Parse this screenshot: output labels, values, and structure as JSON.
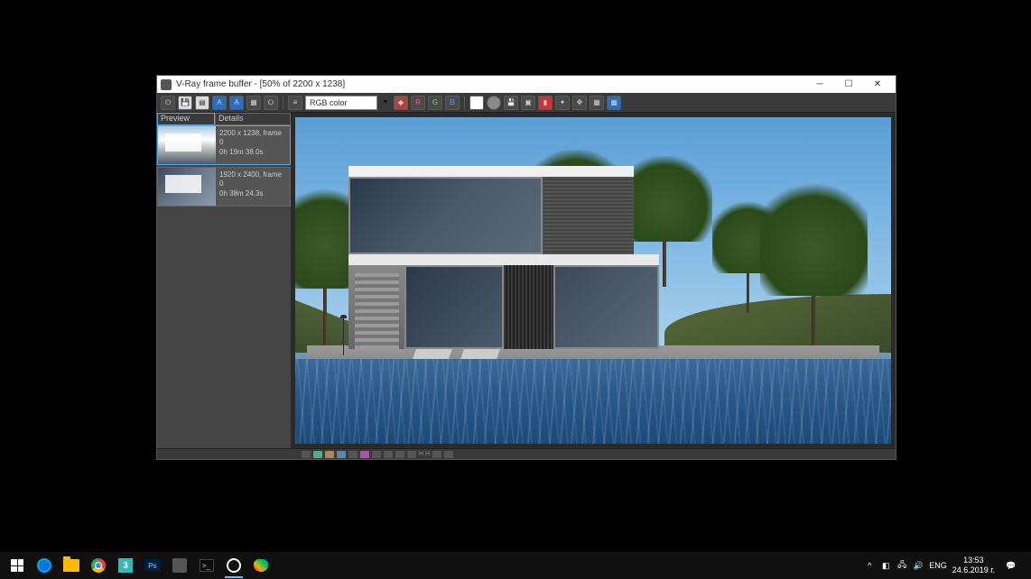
{
  "window": {
    "title": "V-Ray frame buffer - [50% of 2200 x 1238]"
  },
  "toolbar": {
    "channel_label": "RGB color",
    "r": "R",
    "g": "G",
    "b": "B",
    "h_label": "H"
  },
  "sidebar": {
    "preview_header": "Preview",
    "details_header": "Details",
    "history": [
      {
        "line1": "2200 x 1238, frame 0",
        "line2": "0h 19m 38.0s",
        "selected": true
      },
      {
        "line1": "1920 x 2400, frame 0",
        "line2": "0h 38m 24.3s",
        "selected": false
      }
    ]
  },
  "statusbar": {
    "hh": "H H"
  },
  "taskbar": {
    "max_label": "3",
    "ps_label": "Ps",
    "term_label": ">_",
    "tray": {
      "chevron": "^",
      "lang": "ENG",
      "time": "13:53",
      "date": "24.6.2019 г."
    }
  }
}
